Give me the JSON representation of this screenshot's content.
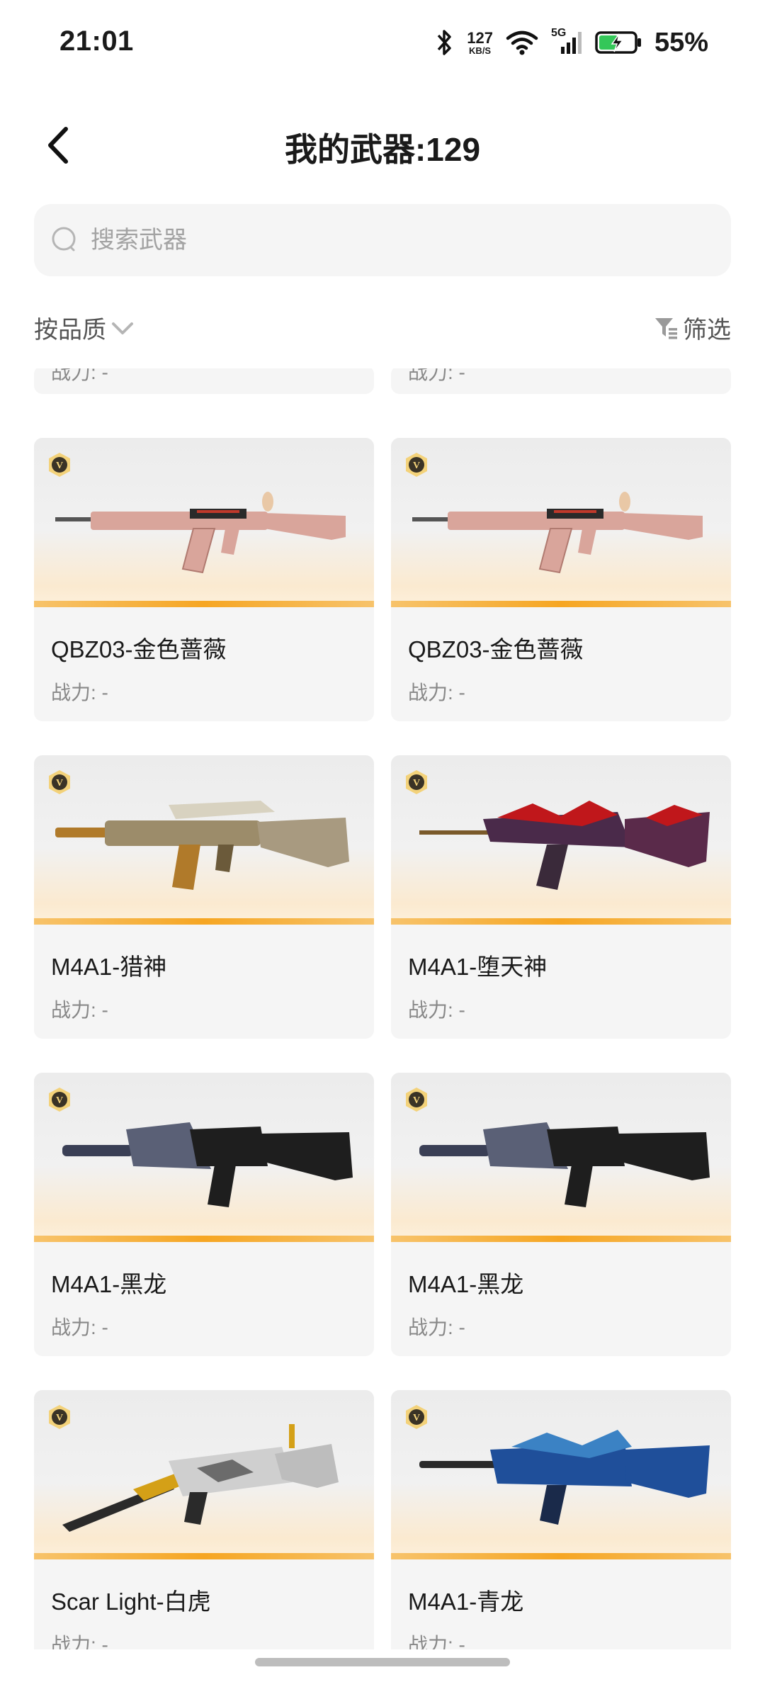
{
  "status_bar": {
    "time": "21:01",
    "net_speed_value": "127",
    "net_speed_unit": "KB/S",
    "network": "5G",
    "battery_percent": "55%",
    "icons": [
      "bluetooth-icon",
      "wifi-icon",
      "signal-icon",
      "battery-charging-icon"
    ]
  },
  "header": {
    "title": "我的武器:129",
    "back_icon": "back-arrow-icon"
  },
  "search": {
    "placeholder": "搜索武器",
    "value": ""
  },
  "toolbar": {
    "sort_label": "按品质",
    "filter_label": "筛选"
  },
  "weapons": [
    {
      "name": "",
      "power": "战力: -"
    },
    {
      "name": "",
      "power": "战力: -"
    },
    {
      "name": "QBZ03-金色蔷薇",
      "power": "战力: -",
      "badge": "V",
      "color": "#d9a59b"
    },
    {
      "name": "QBZ03-金色蔷薇",
      "power": "战力: -",
      "badge": "V",
      "color": "#d9a59b"
    },
    {
      "name": "M4A1-猎神",
      "power": "战力: -",
      "badge": "V",
      "color": "#b07a2a"
    },
    {
      "name": "M4A1-堕天神",
      "power": "战力: -",
      "badge": "V",
      "color": "#8b1a1a"
    },
    {
      "name": "M4A1-黑龙",
      "power": "战力: -",
      "badge": "V",
      "color": "#2b2b2b"
    },
    {
      "name": "M4A1-黑龙",
      "power": "战力: -",
      "badge": "V",
      "color": "#2b2b2b"
    },
    {
      "name": "Scar Light-白虎",
      "power": "战力: -",
      "badge": "V",
      "color": "#c9c9c9"
    },
    {
      "name": "M4A1-青龙",
      "power": "战力: -",
      "badge": "V",
      "color": "#1f4f9a"
    }
  ]
}
